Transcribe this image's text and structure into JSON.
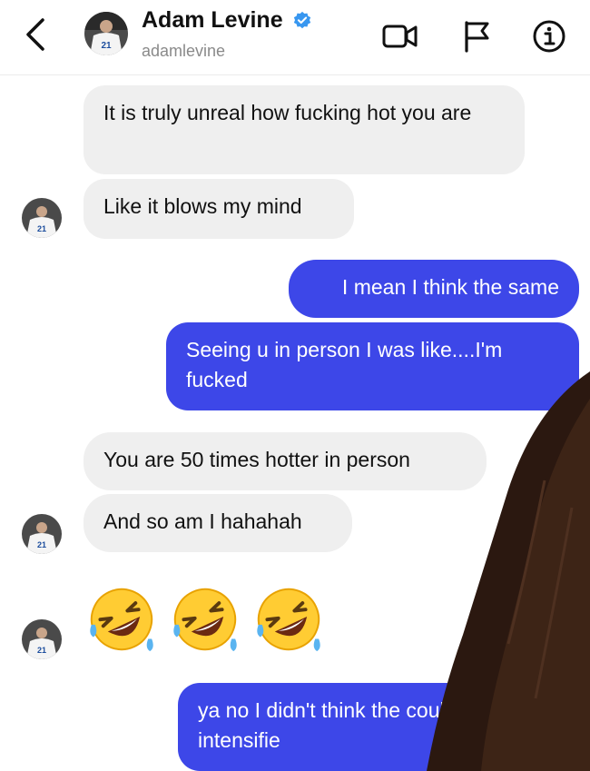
{
  "header": {
    "name": "Adam Levine",
    "handle": "adamlevine",
    "icons": {
      "back": "chevron-left-icon",
      "video": "video-call-icon",
      "flag": "flag-icon",
      "info": "info-icon",
      "verified": "verified-badge-icon"
    },
    "colors": {
      "verified": "#3897f0"
    }
  },
  "messages": [
    {
      "from": "them",
      "text": "It is truly unreal how fucking hot you are"
    },
    {
      "from": "them",
      "text": "Like it blows my mind"
    },
    {
      "from": "me",
      "text": "I mean I think the same"
    },
    {
      "from": "me",
      "text": "Seeing u in person I was like....I'm fucked"
    },
    {
      "from": "them",
      "text": "You are 50 times hotter in person"
    },
    {
      "from": "them",
      "text": "And so am I hahahah"
    },
    {
      "from": "them",
      "text": "🤣🤣🤣",
      "kind": "emoji",
      "emoji": "rolling-on-floor-laughing-icon"
    },
    {
      "from": "me",
      "text": "ya no I didn't think the could be intensifie"
    }
  ],
  "colors": {
    "incoming_bubble": "#efefef",
    "outgoing_bubble": "#3d47e8",
    "background": "#ffffff"
  }
}
